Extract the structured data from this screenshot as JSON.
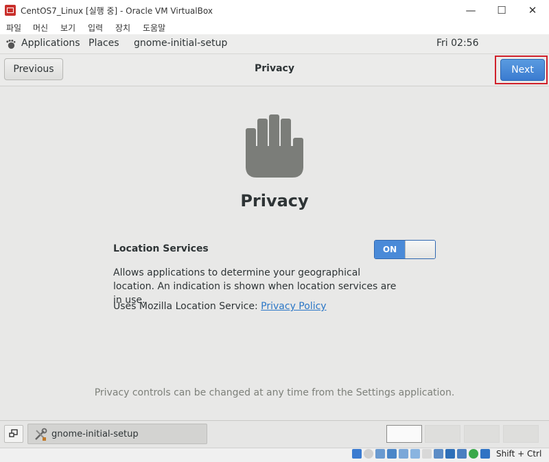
{
  "window": {
    "title": "CentOS7_Linux [실행 중] - Oracle VM VirtualBox",
    "controls": {
      "minimize": "—",
      "maximize": "☐",
      "close": "✕"
    }
  },
  "vm_menu": [
    "파일",
    "머신",
    "보기",
    "입력",
    "장치",
    "도움말"
  ],
  "gnome_top": {
    "applications": "Applications",
    "places": "Places",
    "app_name": "gnome-initial-setup",
    "clock": "Fri 02:56"
  },
  "header": {
    "previous": "Previous",
    "title": "Privacy",
    "next": "Next"
  },
  "privacy": {
    "heading": "Privacy",
    "location_label": "Location Services",
    "toggle_state": "ON",
    "description": "Allows applications to determine your geographical location. An indication is shown when location services are in use.",
    "uses_prefix": "Uses Mozilla Location Service:",
    "policy_link": "Privacy Policy",
    "footer": "Privacy controls can be changed at any time from the Settings application."
  },
  "taskbar": {
    "task_label": "gnome-initial-setup"
  },
  "statusbar": {
    "host_key": "Shift + Ctrl"
  },
  "colors": {
    "accent": "#4a8ad8",
    "highlight_box": "#d0202a",
    "link": "#2a76c6"
  }
}
